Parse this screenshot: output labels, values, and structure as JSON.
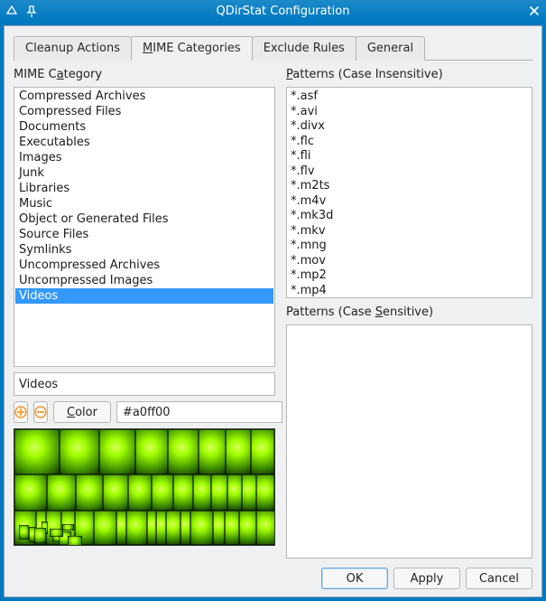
{
  "window": {
    "title": "QDirStat Configuration"
  },
  "tabs": {
    "cleanup": "Cleanup Actions",
    "mime": "MIME Categories",
    "exclude": "Exclude Rules",
    "general": "General",
    "active": "mime"
  },
  "left": {
    "heading": "MIME Category",
    "categories": [
      "Compressed Archives",
      "Compressed Files",
      "Documents",
      "Executables",
      "Images",
      "Junk",
      "Libraries",
      "Music",
      "Object or Generated Files",
      "Source Files",
      "Symlinks",
      "Uncompressed Archives",
      "Uncompressed Images",
      "Videos"
    ],
    "selected_index": 13,
    "name_value": "Videos",
    "color_button": "Color",
    "color_value": "#a0ff00"
  },
  "right": {
    "ci_heading": "Patterns (Case Insensitive)",
    "ci_patterns": [
      "*.asf",
      "*.avi",
      "*.divx",
      "*.flc",
      "*.fli",
      "*.flv",
      "*.m2ts",
      "*.m4v",
      "*.mk3d",
      "*.mkv",
      "*.mng",
      "*.mov",
      "*.mp2",
      "*.mp4"
    ],
    "cs_heading": "Patterns (Case Sensitive)",
    "cs_patterns": []
  },
  "footer": {
    "ok": "OK",
    "apply": "Apply",
    "cancel": "Cancel"
  },
  "icons": {
    "add": "add-icon",
    "remove": "remove-icon"
  }
}
